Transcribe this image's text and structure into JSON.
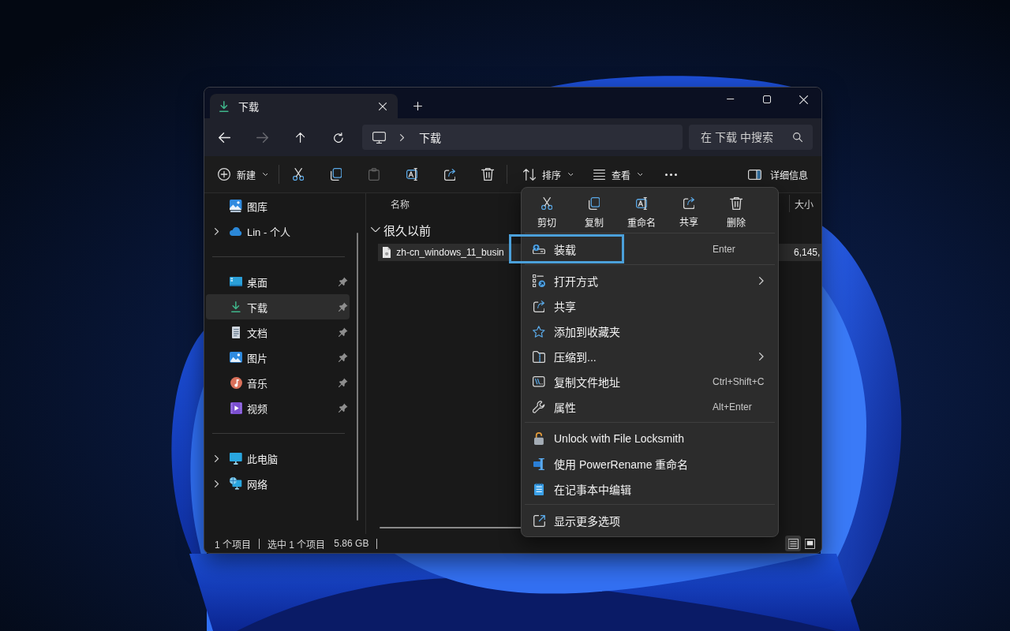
{
  "tabs": [
    {
      "label": "下载",
      "selected": true
    }
  ],
  "nav_buttons": [
    {
      "disabled": false
    },
    {
      "disabled": true
    },
    {
      "disabled": false
    },
    {
      "disabled": false
    }
  ],
  "address_bar": {
    "path": [
      "下载"
    ]
  },
  "search": {
    "placeholder": "在 下载 中搜索"
  },
  "toolbar": {
    "groups": [
      {
        "buttons": [
          {
            "label": "新建",
            "dropdown": true,
            "disabled": false
          }
        ]
      },
      {
        "buttons": [
          {
            "dropdown": false,
            "disabled": false
          },
          {
            "dropdown": false,
            "disabled": false
          },
          {
            "dropdown": false,
            "disabled": true
          },
          {
            "dropdown": false,
            "disabled": false
          },
          {
            "dropdown": false,
            "disabled": false
          },
          {
            "dropdown": false,
            "disabled": false
          }
        ]
      },
      {
        "buttons": [
          {
            "label": "排序",
            "dropdown": true,
            "disabled": false
          },
          {
            "label": "查看",
            "dropdown": true,
            "disabled": false
          },
          {
            "dropdown": false,
            "disabled": false
          }
        ]
      }
    ],
    "details_button": {
      "label": "详细信息"
    }
  },
  "sidebar": {
    "sections": [
      {
        "items": [
          {
            "label": "图库",
            "expandable": false,
            "pinned": false,
            "selected": false
          },
          {
            "label": "Lin - 个人",
            "expandable": true,
            "pinned": false,
            "selected": false
          }
        ]
      },
      {
        "items": [
          {
            "label": "桌面",
            "expandable": false,
            "pinned": true,
            "selected": false
          },
          {
            "label": "下载",
            "expandable": false,
            "pinned": true,
            "selected": true
          },
          {
            "label": "文档",
            "expandable": false,
            "pinned": true,
            "selected": false
          },
          {
            "label": "图片",
            "expandable": false,
            "pinned": true,
            "selected": false
          },
          {
            "label": "音乐",
            "expandable": false,
            "pinned": true,
            "selected": false
          },
          {
            "label": "视频",
            "expandable": false,
            "pinned": true,
            "selected": false
          }
        ]
      },
      {
        "items": [
          {
            "label": "此电脑",
            "expandable": true,
            "pinned": false,
            "selected": false
          },
          {
            "label": "网络",
            "expandable": true,
            "pinned": false,
            "selected": false
          }
        ]
      }
    ]
  },
  "file_list": {
    "columns": [
      "名称",
      "大小"
    ],
    "groups": [
      {
        "label": "很久以前",
        "expanded": true,
        "files": [
          {
            "name": "zh-cn_windows_11_busin",
            "size": "6,145,",
            "selected": true
          }
        ]
      }
    ]
  },
  "status_bar": {
    "item_count": "1 个项目",
    "selection": "选中 1 个项目",
    "selection_size": "5.86 GB",
    "view_modes": [
      {
        "selected": true
      },
      {
        "selected": false
      }
    ]
  },
  "context_menu": {
    "quick_actions": [
      {
        "label": "剪切"
      },
      {
        "label": "复制"
      },
      {
        "label": "重命名"
      },
      {
        "label": "共享"
      },
      {
        "label": "删除"
      }
    ],
    "sections": [
      {
        "items": [
          {
            "label": "装载",
            "shortcut": "Enter",
            "submenu": false,
            "highlighted": true
          }
        ]
      },
      {
        "items": [
          {
            "label": "打开方式",
            "submenu": true,
            "highlighted": false
          },
          {
            "label": "共享",
            "submenu": false,
            "highlighted": false
          },
          {
            "label": "添加到收藏夹",
            "submenu": false,
            "highlighted": false
          },
          {
            "label": "压缩到...",
            "submenu": true,
            "highlighted": false
          },
          {
            "label": "复制文件地址",
            "shortcut": "Ctrl+Shift+C",
            "submenu": false,
            "highlighted": false
          },
          {
            "label": "属性",
            "shortcut": "Alt+Enter",
            "submenu": false,
            "highlighted": false
          }
        ]
      },
      {
        "items": [
          {
            "label": "Unlock with File Locksmith",
            "submenu": false,
            "highlighted": false
          },
          {
            "label": "使用 PowerRename 重命名",
            "submenu": false,
            "highlighted": false
          },
          {
            "label": "在记事本中编辑",
            "submenu": false,
            "highlighted": false
          }
        ]
      },
      {
        "items": [
          {
            "label": "显示更多选项",
            "submenu": false,
            "highlighted": false
          }
        ]
      }
    ]
  }
}
